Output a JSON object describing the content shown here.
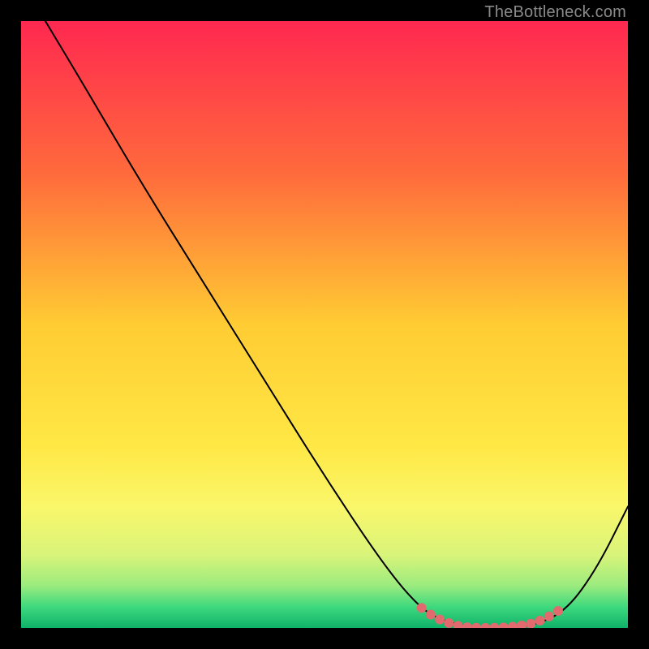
{
  "watermark": "TheBottleneck.com",
  "chart_data": {
    "type": "line",
    "title": "",
    "xlabel": "",
    "ylabel": "",
    "x_range": [
      0,
      100
    ],
    "y_range": [
      0,
      100
    ],
    "gradient_stops": [
      {
        "offset": 0,
        "color": "#ff2850"
      },
      {
        "offset": 0.25,
        "color": "#ff6a3c"
      },
      {
        "offset": 0.5,
        "color": "#ffcc33"
      },
      {
        "offset": 0.7,
        "color": "#ffe845"
      },
      {
        "offset": 0.8,
        "color": "#faf76a"
      },
      {
        "offset": 0.88,
        "color": "#d8f47a"
      },
      {
        "offset": 0.93,
        "color": "#9ceb7e"
      },
      {
        "offset": 0.965,
        "color": "#3fd97e"
      },
      {
        "offset": 1.0,
        "color": "#0fb26a"
      }
    ],
    "series": [
      {
        "name": "curve",
        "stroke": "#000000",
        "stroke_width": 2,
        "points": [
          {
            "x": 4,
            "y": 100
          },
          {
            "x": 10,
            "y": 90
          },
          {
            "x": 20,
            "y": 73
          },
          {
            "x": 30,
            "y": 57
          },
          {
            "x": 40,
            "y": 41
          },
          {
            "x": 50,
            "y": 25
          },
          {
            "x": 60,
            "y": 10
          },
          {
            "x": 66,
            "y": 3
          },
          {
            "x": 70,
            "y": 1
          },
          {
            "x": 75,
            "y": 0
          },
          {
            "x": 80,
            "y": 0
          },
          {
            "x": 85,
            "y": 0.5
          },
          {
            "x": 90,
            "y": 3
          },
          {
            "x": 95,
            "y": 10
          },
          {
            "x": 100,
            "y": 20
          }
        ]
      },
      {
        "name": "highlight-dots",
        "stroke": "#e06a6e",
        "dot_radius": 6,
        "points": [
          {
            "x": 66,
            "y": 3.3
          },
          {
            "x": 67.5,
            "y": 2.2
          },
          {
            "x": 69,
            "y": 1.4
          },
          {
            "x": 70.5,
            "y": 0.8
          },
          {
            "x": 72,
            "y": 0.35
          },
          {
            "x": 73.5,
            "y": 0.12
          },
          {
            "x": 75,
            "y": 0.03
          },
          {
            "x": 76.5,
            "y": 0.02
          },
          {
            "x": 78,
            "y": 0.03
          },
          {
            "x": 79.5,
            "y": 0.08
          },
          {
            "x": 81,
            "y": 0.2
          },
          {
            "x": 82.5,
            "y": 0.4
          },
          {
            "x": 84,
            "y": 0.7
          },
          {
            "x": 85.5,
            "y": 1.2
          },
          {
            "x": 87,
            "y": 1.9
          },
          {
            "x": 88.5,
            "y": 2.8
          }
        ]
      }
    ]
  }
}
